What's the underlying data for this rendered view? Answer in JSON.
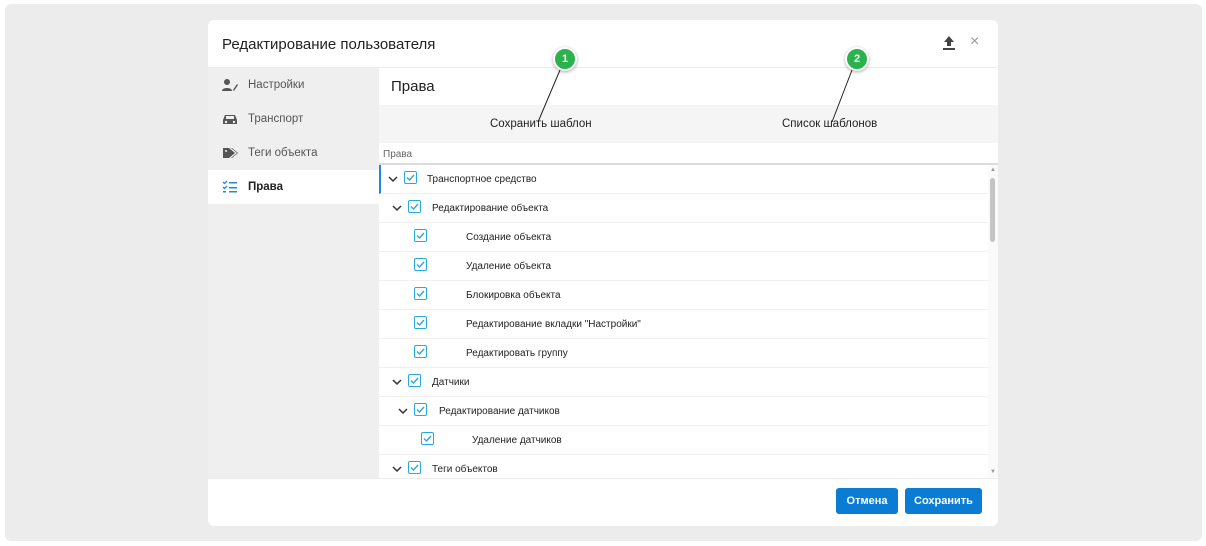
{
  "dialog": {
    "title": "Редактирование пользователя",
    "upload_icon": "upload-icon",
    "close_label": "×"
  },
  "sidebar": {
    "items": [
      {
        "label": "Настройки",
        "icon": "user-edit-icon",
        "active": false
      },
      {
        "label": "Транспорт",
        "icon": "car-icon",
        "active": false
      },
      {
        "label": "Теги объекта",
        "icon": "tags-icon",
        "active": false
      },
      {
        "label": "Права",
        "icon": "checklist-icon",
        "active": true
      }
    ]
  },
  "main": {
    "title": "Права",
    "templates": {
      "save_template": "Сохранить шаблон",
      "template_list": "Список шаблонов"
    },
    "column_header": "Права",
    "tree": [
      {
        "label": "Транспортное средство",
        "checked": true,
        "expandable": true,
        "level": 0
      },
      {
        "label": "Редактирование объекта",
        "checked": true,
        "expandable": true,
        "level": 1
      },
      {
        "label": "Создание объекта",
        "checked": true,
        "expandable": false,
        "level": 2
      },
      {
        "label": "Удаление объекта",
        "checked": true,
        "expandable": false,
        "level": 2
      },
      {
        "label": "Блокировка объекта",
        "checked": true,
        "expandable": false,
        "level": 2
      },
      {
        "label": "Редактирование вкладки \"Настройки\"",
        "checked": true,
        "expandable": false,
        "level": 2
      },
      {
        "label": "Редактировать группу",
        "checked": true,
        "expandable": false,
        "level": 2
      },
      {
        "label": "Датчики",
        "checked": true,
        "expandable": true,
        "level": 0
      },
      {
        "label": "Редактирование датчиков",
        "checked": true,
        "expandable": true,
        "level": 1
      },
      {
        "label": "Удаление датчиков",
        "checked": true,
        "expandable": false,
        "level": 2
      },
      {
        "label": "Теги объектов",
        "checked": true,
        "expandable": true,
        "level": 0
      }
    ]
  },
  "footer": {
    "cancel_label": "Отмена",
    "save_label": "Сохранить"
  },
  "callouts": [
    "1",
    "2"
  ],
  "colors": {
    "accent": "#0a7cd4",
    "checkbox": "#29a8e0",
    "callout": "#2bb24c"
  }
}
